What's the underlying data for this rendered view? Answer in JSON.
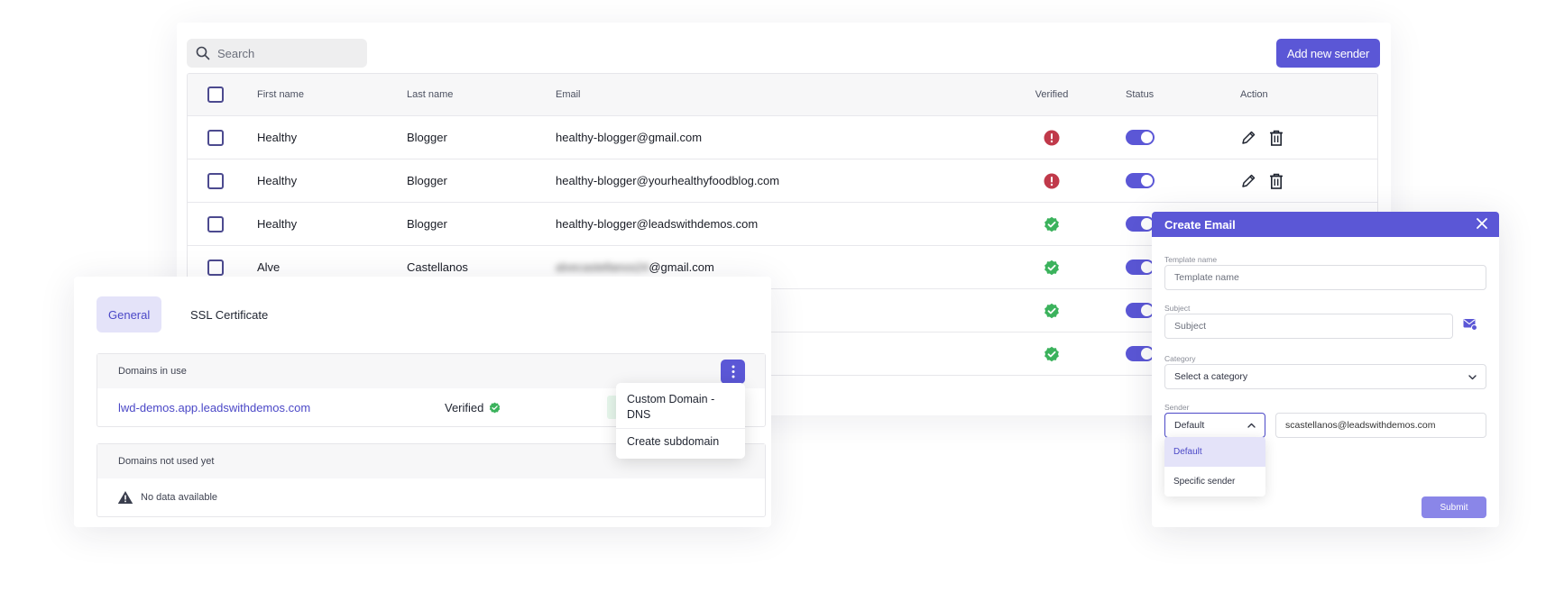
{
  "colors": {
    "accent": "#5b57d6",
    "error": "#c0394a",
    "success": "#3bb25c",
    "accent_light": "#e4e3f9"
  },
  "senders": {
    "search_placeholder": "Search",
    "add_button": "Add new sender",
    "columns": [
      "First name",
      "Last name",
      "Email",
      "Verified",
      "Status",
      "Action"
    ],
    "rows": [
      {
        "first": "Healthy",
        "last": "Blogger",
        "email": "healthy-blogger@gmail.com",
        "verified": "error",
        "status": "on"
      },
      {
        "first": "Healthy",
        "last": "Blogger",
        "email": "healthy-blogger@yourhealthyfoodblog.com",
        "verified": "error",
        "status": "on"
      },
      {
        "first": "Healthy",
        "last": "Blogger",
        "email": "healthy-blogger@leadswithdemos.com",
        "verified": "success",
        "status": "on"
      },
      {
        "first": "Alve",
        "last": "Castellanos",
        "email_blurred": "alvecastellanos24",
        "email_visible": "@gmail.com",
        "verified": "success",
        "status": "on"
      }
    ],
    "extra_verified_rows": [
      "success",
      "success"
    ]
  },
  "domains": {
    "tabs": [
      "General",
      "SSL Certificate"
    ],
    "in_use_header": "Domains in use",
    "domain": "lwd-demos.app.leadswithdemos.com",
    "verified_label": "Verified",
    "menu": [
      "Custom Domain - DNS",
      "Create subdomain"
    ],
    "not_used_header": "Domains not used yet",
    "empty_text": "No data available"
  },
  "email_modal": {
    "title": "Create Email",
    "template_label": "Template name",
    "template_placeholder": "Template name",
    "subject_label": "Subject",
    "subject_placeholder": "Subject",
    "category_label": "Category",
    "category_value": "Select a category",
    "sender_label": "Sender",
    "sender_value": "Default",
    "sender_email": "scastellanos@leadswithdemos.com",
    "sender_options": [
      "Default",
      "Specific sender"
    ],
    "submit": "Submit"
  }
}
